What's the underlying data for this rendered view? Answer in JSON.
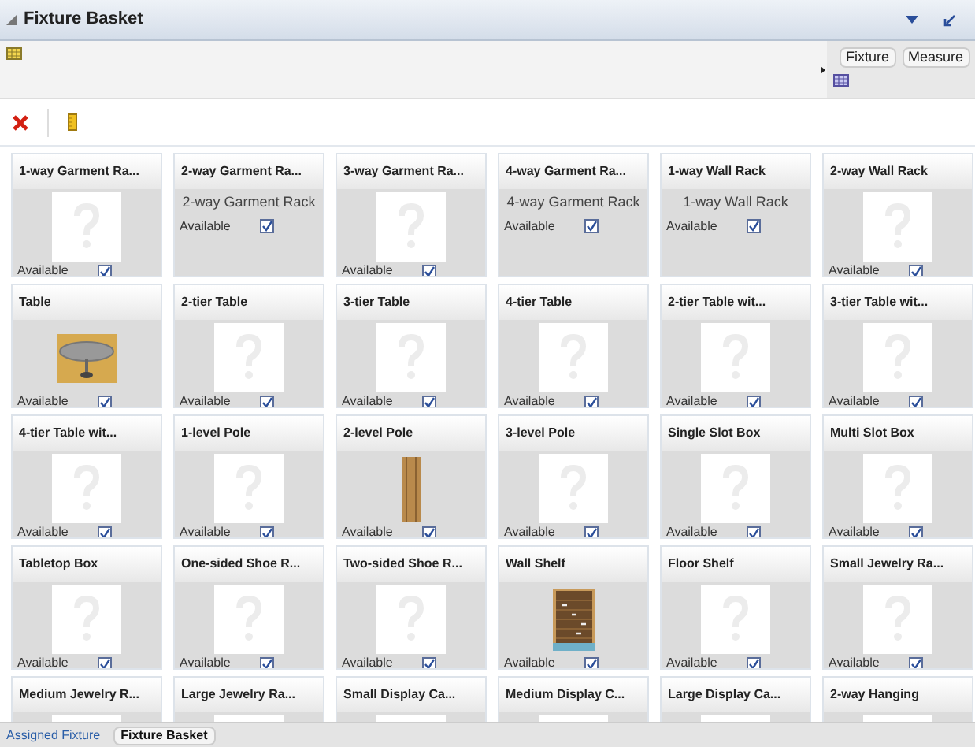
{
  "panel": {
    "title": "Fixture Basket"
  },
  "side_buttons": [
    "Fixture",
    "Measure"
  ],
  "cards": [
    {
      "title": "1-way Garment Ra...",
      "kind": "placeholder",
      "available": "Available",
      "checked": true
    },
    {
      "title": "2-way Garment Ra...",
      "kind": "caption",
      "caption": "2-way Garment Rack",
      "available": "Available",
      "checked": true
    },
    {
      "title": "3-way Garment Ra...",
      "kind": "placeholder",
      "available": "Available",
      "checked": true
    },
    {
      "title": "4-way Garment Ra...",
      "kind": "caption",
      "caption": "4-way Garment Rack",
      "available": "Available",
      "checked": true
    },
    {
      "title": "1-way Wall Rack",
      "kind": "caption",
      "caption": "1-way Wall Rack",
      "available": "Available",
      "checked": true
    },
    {
      "title": "2-way Wall Rack",
      "kind": "placeholder",
      "available": "Available",
      "checked": true
    },
    {
      "title": "Table",
      "kind": "table",
      "available": "Available",
      "checked": true
    },
    {
      "title": "2-tier Table",
      "kind": "placeholder",
      "available": "Available",
      "checked": true
    },
    {
      "title": "3-tier Table",
      "kind": "placeholder",
      "available": "Available",
      "checked": true
    },
    {
      "title": "4-tier Table",
      "kind": "placeholder",
      "available": "Available",
      "checked": true
    },
    {
      "title": "2-tier Table wit...",
      "kind": "placeholder",
      "available": "Available",
      "checked": true
    },
    {
      "title": "3-tier Table wit...",
      "kind": "placeholder",
      "available": "Available",
      "checked": true
    },
    {
      "title": "4-tier Table wit...",
      "kind": "placeholder",
      "available": "Available",
      "checked": true
    },
    {
      "title": "1-level Pole",
      "kind": "placeholder",
      "available": "Available",
      "checked": true
    },
    {
      "title": "2-level Pole",
      "kind": "pole",
      "available": "Available",
      "checked": true
    },
    {
      "title": "3-level Pole",
      "kind": "placeholder",
      "available": "Available",
      "checked": true
    },
    {
      "title": "Single Slot Box",
      "kind": "placeholder",
      "available": "Available",
      "checked": true
    },
    {
      "title": "Multi Slot Box",
      "kind": "placeholder",
      "available": "Available",
      "checked": true
    },
    {
      "title": "Tabletop Box",
      "kind": "placeholder",
      "available": "Available",
      "checked": true
    },
    {
      "title": "One-sided Shoe R...",
      "kind": "placeholder",
      "available": "Available",
      "checked": true
    },
    {
      "title": "Two-sided Shoe R...",
      "kind": "placeholder",
      "available": "Available",
      "checked": true
    },
    {
      "title": "Wall Shelf",
      "kind": "shelf",
      "available": "Available",
      "checked": true
    },
    {
      "title": "Floor Shelf",
      "kind": "placeholder",
      "available": "Available",
      "checked": true
    },
    {
      "title": "Small Jewelry Ra...",
      "kind": "placeholder",
      "available": "Available",
      "checked": true
    },
    {
      "title": "Medium Jewelry R...",
      "kind": "placeholder"
    },
    {
      "title": "Large Jewelry Ra...",
      "kind": "placeholder"
    },
    {
      "title": "Small Display Ca...",
      "kind": "placeholder"
    },
    {
      "title": "Medium Display C...",
      "kind": "placeholder"
    },
    {
      "title": "Large Display Ca...",
      "kind": "placeholder"
    },
    {
      "title": "2-way Hanging",
      "kind": "placeholder"
    }
  ],
  "bottom_tabs": [
    {
      "label": "Assigned Fixture",
      "selected": false
    },
    {
      "label": "Fixture Basket",
      "selected": true
    }
  ]
}
